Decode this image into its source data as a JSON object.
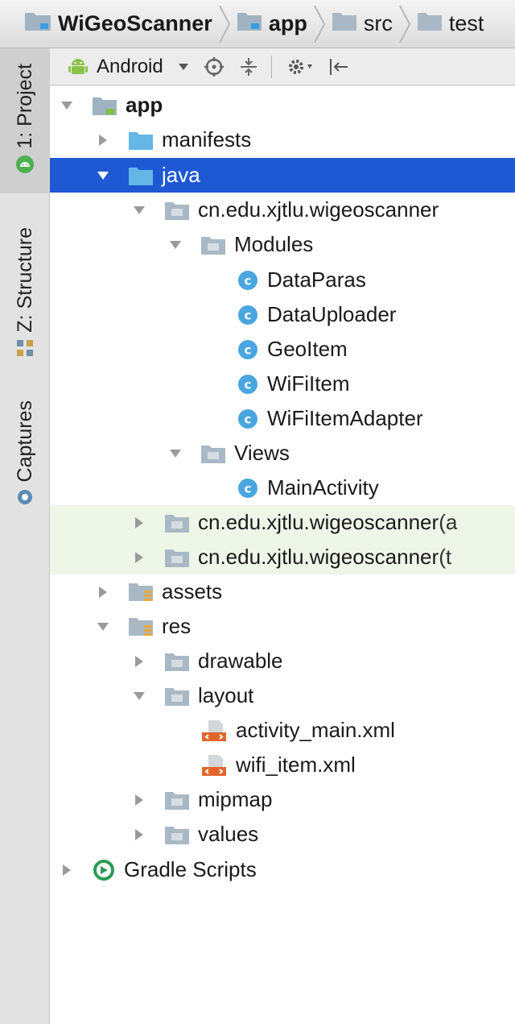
{
  "breadcrumb": {
    "items": [
      {
        "label": "WiGeoScanner",
        "bold": true
      },
      {
        "label": "app",
        "bold": true
      },
      {
        "label": "src",
        "bold": false
      },
      {
        "label": "test",
        "bold": false
      }
    ]
  },
  "side_tabs": [
    {
      "label": "1: Project",
      "active": true
    },
    {
      "label": "Z: Structure",
      "active": false
    },
    {
      "label": "Captures",
      "active": false
    }
  ],
  "toolbar": {
    "view_label": "Android"
  },
  "tree": {
    "rows": [
      {
        "label": "app",
        "suffix": "",
        "bold": true,
        "state": "expanded",
        "icon": "module-folder-icon"
      },
      {
        "label": "manifests",
        "suffix": "",
        "state": "collapsed",
        "icon": "folder-icon"
      },
      {
        "label": "java",
        "suffix": "",
        "state": "expanded",
        "icon": "folder-icon"
      },
      {
        "label": "cn.edu.xjtlu.wigeoscanner",
        "suffix": "",
        "state": "expanded",
        "icon": "package-icon"
      },
      {
        "label": "Modules",
        "suffix": "",
        "state": "expanded",
        "icon": "package-icon"
      },
      {
        "label": "DataParas",
        "suffix": "",
        "state": "none",
        "icon": "class-icon"
      },
      {
        "label": "DataUploader",
        "suffix": "",
        "state": "none",
        "icon": "class-icon"
      },
      {
        "label": "GeoItem",
        "suffix": "",
        "state": "none",
        "icon": "class-icon"
      },
      {
        "label": "WiFiItem",
        "suffix": "",
        "state": "none",
        "icon": "class-icon"
      },
      {
        "label": "WiFiItemAdapter",
        "suffix": "",
        "state": "none",
        "icon": "class-icon"
      },
      {
        "label": "Views",
        "suffix": "",
        "state": "expanded",
        "icon": "package-icon"
      },
      {
        "label": "MainActivity",
        "suffix": "",
        "state": "none",
        "icon": "class-icon"
      },
      {
        "label": "cn.edu.xjtlu.wigeoscanner",
        "suffix": " (a",
        "state": "collapsed",
        "icon": "package-icon"
      },
      {
        "label": "cn.edu.xjtlu.wigeoscanner",
        "suffix": " (t",
        "state": "collapsed",
        "icon": "package-icon"
      },
      {
        "label": "assets",
        "suffix": "",
        "state": "collapsed",
        "icon": "resource-folder-icon"
      },
      {
        "label": "res",
        "suffix": "",
        "state": "expanded",
        "icon": "resource-folder-icon"
      },
      {
        "label": "drawable",
        "suffix": "",
        "state": "collapsed",
        "icon": "package-icon"
      },
      {
        "label": "layout",
        "suffix": "",
        "state": "expanded",
        "icon": "package-icon"
      },
      {
        "label": "activity_main.xml",
        "suffix": "",
        "state": "none",
        "icon": "xml-file-icon"
      },
      {
        "label": "wifi_item.xml",
        "suffix": "",
        "state": "none",
        "icon": "xml-file-icon"
      },
      {
        "label": "mipmap",
        "suffix": "",
        "state": "collapsed",
        "icon": "package-icon"
      },
      {
        "label": "values",
        "suffix": "",
        "state": "collapsed",
        "icon": "package-icon"
      },
      {
        "label": "Gradle Scripts",
        "suffix": "",
        "state": "collapsed",
        "icon": "gradle-icon"
      }
    ]
  },
  "colors": {
    "selection": "#1e59d3",
    "tinted_row": "#eef6e8",
    "class_icon": "#4aa6e0",
    "android_green": "#8bc34a"
  }
}
